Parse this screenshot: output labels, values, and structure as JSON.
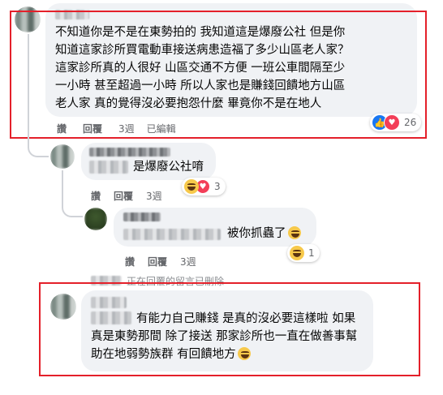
{
  "comment1": {
    "lines": [
      "不知道你是不是在東勢拍的 我知道這是爆廢公社 但是你",
      "知道這家診所買電動車接送病患造福了多少山區老人家？",
      "這家診所真的人很好 山區交通不方便 一班公車間隔至少",
      "一小時 甚至超過一小時 所以人家也是賺錢回饋地方山區",
      "老人家 真的覺得沒必要抱怨什麼 畢竟你不是在地人"
    ],
    "actions": {
      "like": "讚",
      "reply": "回覆",
      "time": "3週",
      "edited": "已編輯"
    },
    "reactions_count": "26"
  },
  "reply1": {
    "text": "是爆廢公社唷",
    "actions": {
      "like": "讚",
      "reply": "回覆",
      "time": "3週"
    },
    "reactions_count": "3"
  },
  "reply2": {
    "text": "被你抓蟲了",
    "actions": {
      "like": "讚",
      "reply": "回覆",
      "time": "3週"
    },
    "reactions_count": "1"
  },
  "deleted_notice": "正在回覆的留言已刪除",
  "comment2": {
    "lines": [
      "有能力自己賺錢 是真的沒必要這樣啦 如果",
      "真是東勢那間 除了接送 那家診所也一直在做善事幫",
      "助在地弱勢族群 有回饋地方"
    ]
  },
  "colors": {
    "highlight_box": "#e4202a",
    "bubble": "#f0f2f5",
    "meta_text": "#65676b",
    "like_blue": "#1877f2"
  }
}
